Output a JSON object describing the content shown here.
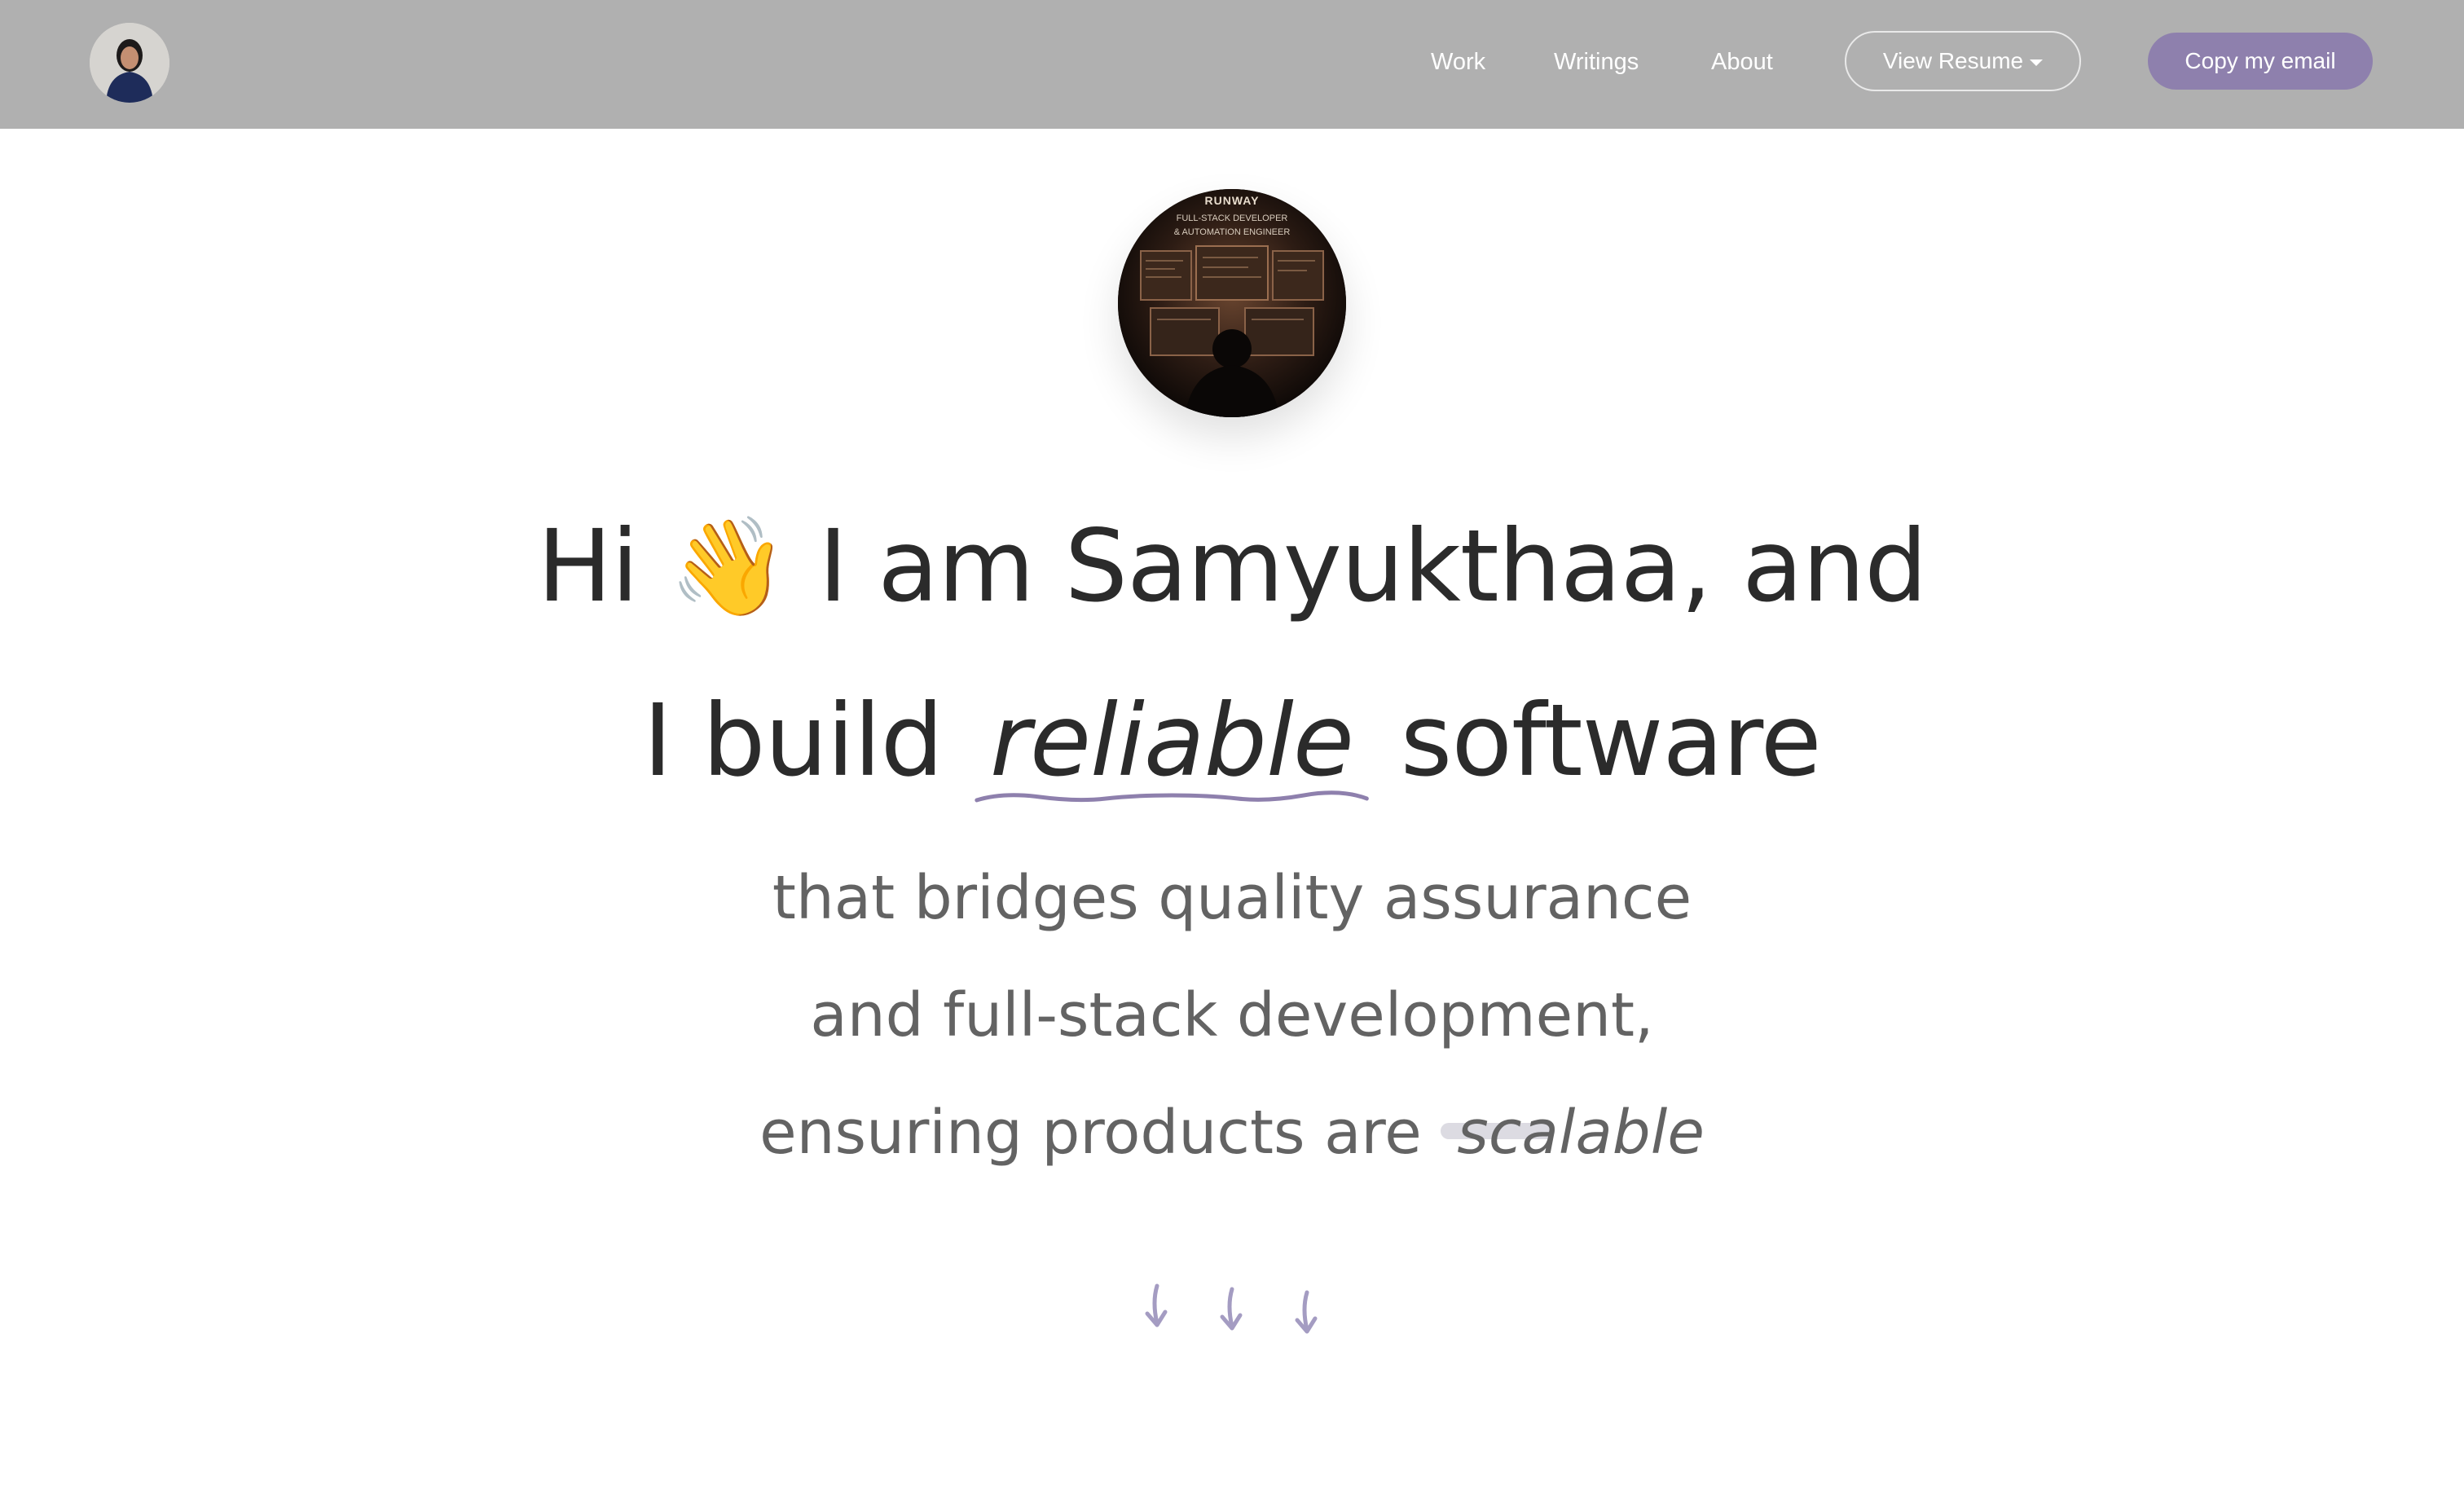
{
  "nav": {
    "links": [
      "Work",
      "Writings",
      "About"
    ],
    "resume_label": "View Resume",
    "email_label": "Copy my email",
    "accent_color": "#8e80ad",
    "bar_color": "#b0b0b0"
  },
  "hero_image": {
    "title": "RUNWAY",
    "subtitle_line1": "FULL-STACK DEVELOPER",
    "subtitle_line2": "& AUTOMATION ENGINEER"
  },
  "headline": {
    "line1_prefix": "Hi",
    "line1_emoji": "👋",
    "line1_suffix": "I am Samyukthaa, and",
    "line2_prefix": "I build",
    "line2_emphasis": "reliable",
    "line2_suffix": "software"
  },
  "subhead": {
    "line1": "that bridges quality assurance",
    "line2": "and full-stack development,",
    "line3_prefix": "ensuring products are",
    "line3_emphasis": "scalable"
  },
  "icons": {
    "scroll_arrows": "down-arrow-icon"
  }
}
